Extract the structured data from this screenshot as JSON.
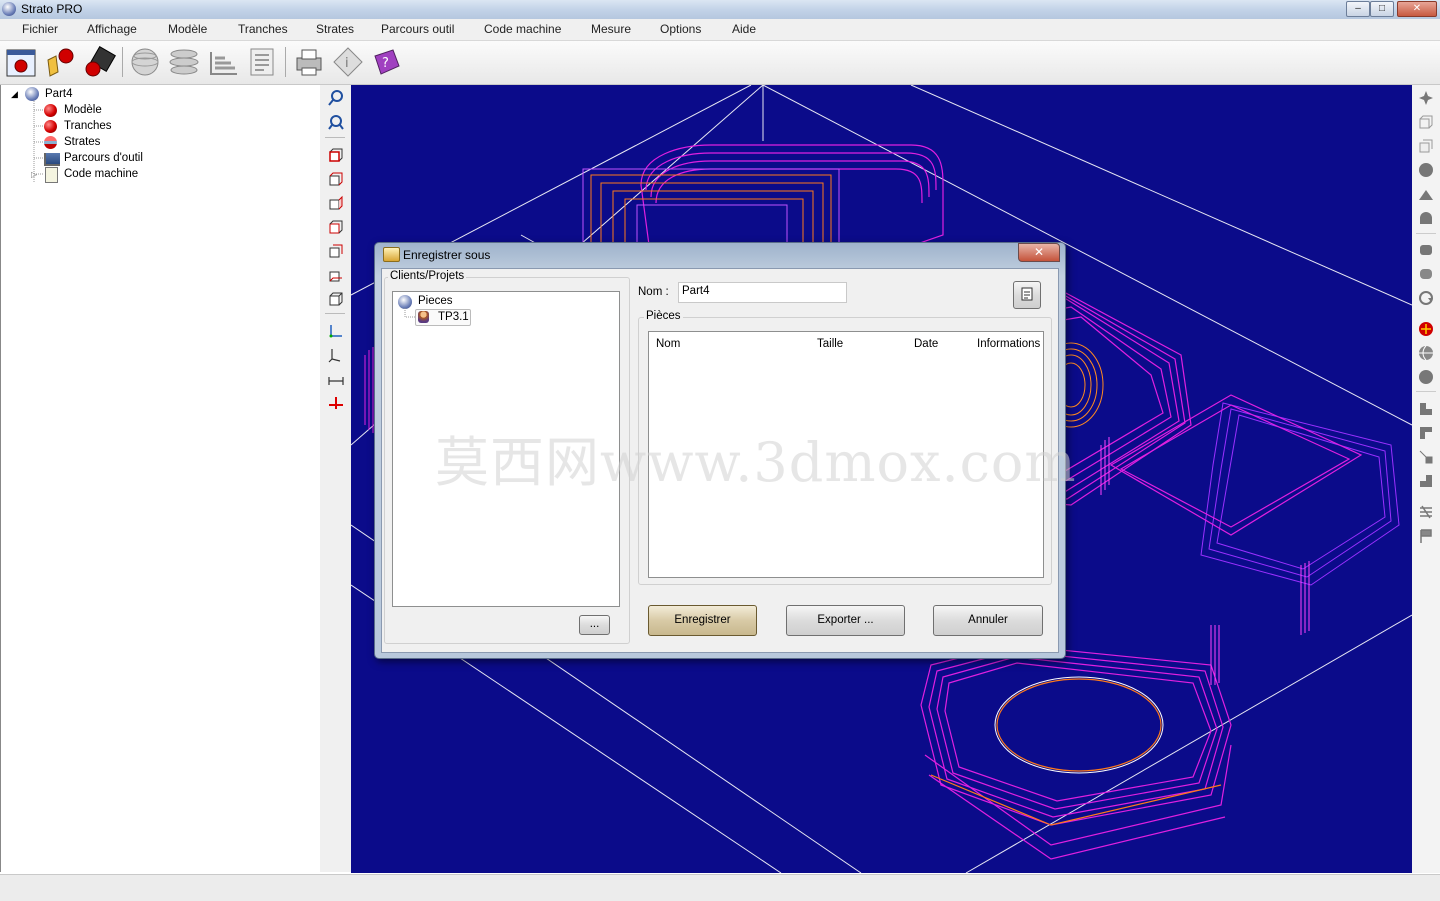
{
  "window": {
    "title": "Strato PRO",
    "controls": {
      "minimize": "–",
      "maximize": "□",
      "close": "✕"
    }
  },
  "menu": [
    "Fichier",
    "Affichage",
    "Modèle",
    "Tranches",
    "Strates",
    "Parcours outil",
    "Code machine",
    "Mesure",
    "Options",
    "Aide"
  ],
  "toolbar": {
    "icons": [
      "new-part-icon",
      "open-part-icon",
      "save-part-icon",
      "sphere-icon",
      "slices-icon",
      "strata-icon",
      "code-icon",
      "print-icon",
      "info-icon",
      "help-icon"
    ]
  },
  "tree": {
    "root": "Part4",
    "children": [
      "Modèle",
      "Tranches",
      "Strates",
      "Parcours d'outil",
      "Code machine"
    ]
  },
  "dialog": {
    "title": "Enregistrer sous",
    "close": "✕",
    "clients_group": "Clients/Projets",
    "clients_root": "Pieces",
    "clients_child": "TP3.1",
    "browse_button": "...",
    "name_label": "Nom :",
    "name_value": "Part4",
    "pieces_group": "Pièces",
    "columns": [
      "Nom",
      "Taille",
      "Date",
      "Informations"
    ],
    "buttons": {
      "save": "Enregistrer",
      "export": "Exporter ...",
      "cancel": "Annuler"
    }
  },
  "watermark": "莫西网www.3dmox.com",
  "colors": {
    "viewport_bg": "#0b0b8a",
    "toolpath_magenta": "#e020e0",
    "toolpath_violet": "#9a30ff",
    "toolpath_orange": "#ff7a1a",
    "grid_line": "#ffffff"
  }
}
